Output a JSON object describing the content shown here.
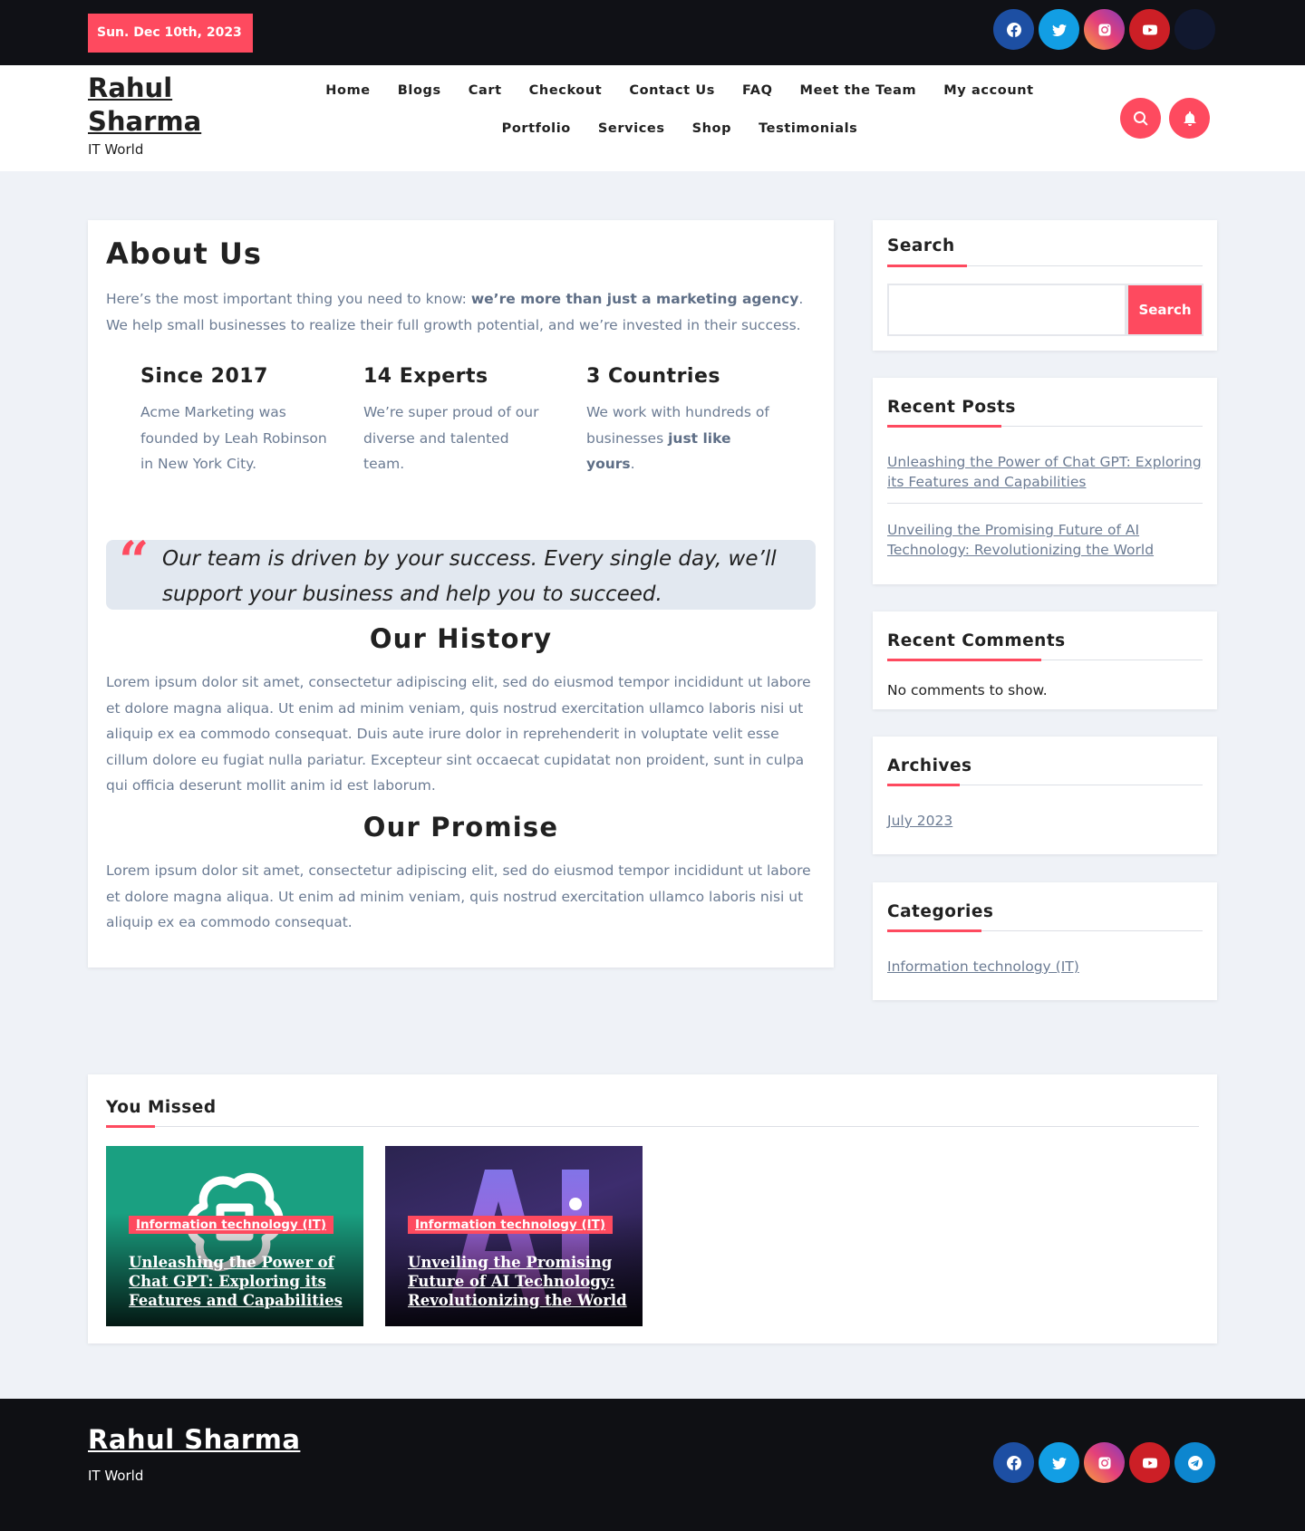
{
  "topbar": {
    "date": "Sun. Dec 10th, 2023",
    "social": [
      "facebook-icon",
      "twitter-icon",
      "instagram-icon",
      "youtube-icon",
      "dark-circle"
    ]
  },
  "header": {
    "site_title": "Rahul Sharma",
    "tagline": "IT World",
    "nav": [
      "Home",
      "Blogs",
      "Cart",
      "Checkout",
      "Contact Us",
      "FAQ",
      "Meet the Team",
      "My account",
      "Portfolio",
      "Services",
      "Shop",
      "Testimonials"
    ],
    "icons": [
      "search-icon",
      "bell-icon"
    ]
  },
  "main": {
    "title": "About Us",
    "intro_pre": "Here’s the most important thing you need to know: ",
    "intro_bold": "we’re more than just a marketing agency",
    "intro_post": ". We help small businesses to realize their full growth potential, and we’re invested in their success.",
    "stats": [
      {
        "heading": "Since 2017",
        "text": "Acme Marketing was founded by Leah Robinson in New York City.",
        "bold": ""
      },
      {
        "heading": "14 Experts",
        "text": "We’re super proud of our diverse and talented team.",
        "bold": ""
      },
      {
        "heading": "3 Countries",
        "text": "We work with hundreds of businesses ",
        "bold": "just like yours",
        "post": "."
      }
    ],
    "quote": "Our team is driven by your success. Every single day, we’ll support your business and help you to succeed.",
    "history_title": "Our History",
    "history_text": "Lorem ipsum dolor sit amet, consectetur adipiscing elit, sed do eiusmod tempor incididunt ut labore et dolore magna aliqua. Ut enim ad minim veniam, quis nostrud exercitation ullamco laboris nisi ut aliquip ex ea commodo consequat. Duis aute irure dolor in reprehenderit in voluptate velit esse cillum dolore eu fugiat nulla pariatur. Excepteur sint occaecat cupidatat non proident, sunt in culpa qui officia deserunt mollit anim id est laborum.",
    "promise_title": "Our Promise",
    "promise_text": "Lorem ipsum dolor sit amet, consectetur adipiscing elit, sed do eiusmod tempor incididunt ut labore et dolore magna aliqua. Ut enim ad minim veniam, quis nostrud exercitation ullamco laboris nisi ut aliquip ex ea commodo consequat."
  },
  "sidebar": {
    "search_title": "Search",
    "search_button": "Search",
    "recent_posts_title": "Recent Posts",
    "recent_posts": [
      "Unleashing the Power of Chat GPT: Exploring its Features and Capabilities",
      "Unveiling the Promising Future of AI Technology: Revolutionizing the World"
    ],
    "recent_comments_title": "Recent Comments",
    "no_comments": "No comments to show.",
    "archives_title": "Archives",
    "archive_item": "July 2023",
    "categories_title": "Categories",
    "category_item": "Information technology (IT)"
  },
  "missed": {
    "title": "You Missed",
    "posts": [
      {
        "category": "Information technology (IT)",
        "title": "Unleashing the Power of Chat GPT: Exploring its Features and Capabilities"
      },
      {
        "category": "Information technology (IT)",
        "title": "Unveiling the Promising Future of AI Technology: Revolutionizing the World"
      }
    ]
  },
  "footer": {
    "site_title": "Rahul Sharma",
    "tagline": "IT World",
    "social": [
      "facebook-icon",
      "twitter-icon",
      "instagram-icon",
      "youtube-icon",
      "telegram-icon"
    ]
  },
  "colors": {
    "accent": "#fe4a5f",
    "dark": "#101116",
    "text_muted": "#6b7b93"
  }
}
